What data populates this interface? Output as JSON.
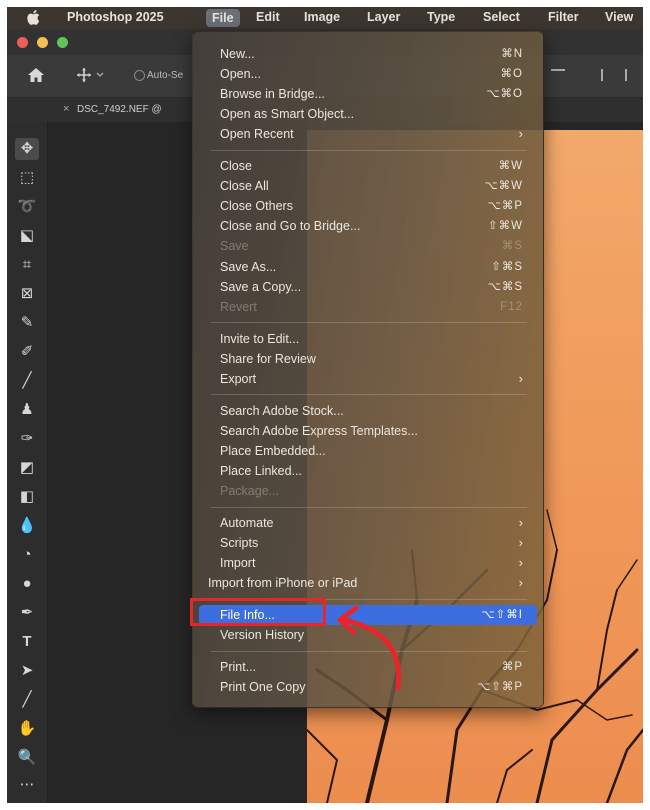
{
  "menubar": {
    "app_name": "Photoshop 2025",
    "items": [
      "File",
      "Edit",
      "Image",
      "Layer",
      "Type",
      "Select",
      "Filter",
      "View"
    ],
    "active": "File"
  },
  "options_bar": {
    "auto_select_label": "Auto-Se"
  },
  "document_tab": {
    "label": "DSC_7492.NEF @",
    "close": "×"
  },
  "file_menu": {
    "groups": [
      [
        {
          "label": "New...",
          "shortcut": "⌘N"
        },
        {
          "label": "Open...",
          "shortcut": "⌘O"
        },
        {
          "label": "Browse in Bridge...",
          "shortcut": "⌥⌘O"
        },
        {
          "label": "Open as Smart Object...",
          "shortcut": ""
        },
        {
          "label": "Open Recent",
          "shortcut": "",
          "submenu": true
        }
      ],
      [
        {
          "label": "Close",
          "shortcut": "⌘W"
        },
        {
          "label": "Close All",
          "shortcut": "⌥⌘W"
        },
        {
          "label": "Close Others",
          "shortcut": "⌥⌘P"
        },
        {
          "label": "Close and Go to Bridge...",
          "shortcut": "⇧⌘W"
        },
        {
          "label": "Save",
          "shortcut": "⌘S",
          "disabled": true
        },
        {
          "label": "Save As...",
          "shortcut": "⇧⌘S"
        },
        {
          "label": "Save a Copy...",
          "shortcut": "⌥⌘S"
        },
        {
          "label": "Revert",
          "shortcut": "F12",
          "disabled": true
        }
      ],
      [
        {
          "label": "Invite to Edit...",
          "shortcut": ""
        },
        {
          "label": "Share for Review",
          "shortcut": ""
        },
        {
          "label": "Export",
          "shortcut": "",
          "submenu": true
        }
      ],
      [
        {
          "label": "Search Adobe Stock...",
          "shortcut": ""
        },
        {
          "label": "Search Adobe Express Templates...",
          "shortcut": ""
        },
        {
          "label": "Place Embedded...",
          "shortcut": ""
        },
        {
          "label": "Place Linked...",
          "shortcut": ""
        },
        {
          "label": "Package...",
          "shortcut": "",
          "disabled": true
        }
      ],
      [
        {
          "label": "Automate",
          "shortcut": "",
          "submenu": true
        },
        {
          "label": "Scripts",
          "shortcut": "",
          "submenu": true
        },
        {
          "label": "Import",
          "shortcut": "",
          "submenu": true
        },
        {
          "label": "Import from iPhone or iPad",
          "shortcut": "",
          "submenu": true
        }
      ],
      [
        {
          "label": "File Info...",
          "shortcut": "⌥⇧⌘I",
          "highlighted": true
        },
        {
          "label": "Version History",
          "shortcut": ""
        }
      ],
      [
        {
          "label": "Print...",
          "shortcut": "⌘P"
        },
        {
          "label": "Print One Copy",
          "shortcut": "⌥⇧⌘P"
        }
      ]
    ]
  },
  "tools": [
    "move-tool",
    "marquee-tool",
    "lasso-tool",
    "object-selection-tool",
    "crop-tool",
    "frame-tool",
    "eyedropper-tool",
    "healing-brush-tool",
    "brush-tool",
    "clone-stamp-tool",
    "history-brush-tool",
    "eraser-tool",
    "gradient-tool",
    "blur-tool",
    "dodge-tool",
    "pen-tool",
    "type-tool",
    "path-selection-tool",
    "line-tool",
    "hand-tool",
    "zoom-tool",
    "more-tools"
  ],
  "colors": {
    "highlight": "#3d6ee0",
    "annotation": "#e8262a",
    "photo_sky": "#f09b5c"
  }
}
